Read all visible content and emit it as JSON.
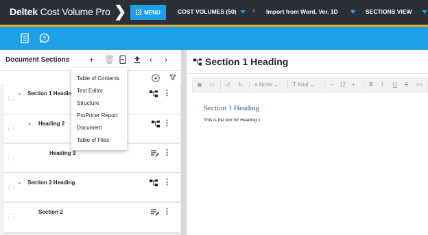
{
  "topbar": {
    "logo_brand": "Deltek",
    "logo_product": "Cost Volume Pro",
    "menu_label": "MENU",
    "cost_volumes": "COST VOLUMES (50)",
    "import_label": "Import from Word, Ver. 1D",
    "view_label": "SECTIONS VIEW",
    "brand_color": "#2b3038",
    "accent": "#1ea0e8",
    "gold": "#e8a92a"
  },
  "bluebar": {
    "icons": [
      "document-list-icon",
      "help-icon"
    ]
  },
  "left_panel": {
    "title": "Document Sections",
    "header_icons": [
      "add-icon",
      "trash-icon",
      "mobile-icon",
      "upload-icon",
      "chevron-left-icon",
      "chevron-right-icon"
    ],
    "rows": [
      {
        "label": "Section 1 Heading",
        "expanded": true,
        "icon": "structure-icon"
      },
      {
        "label": "Heading 2",
        "expanded": true,
        "icon": "structure-icon"
      },
      {
        "label": "Heading 3",
        "expanded": false,
        "icon": "edit-text-icon"
      },
      {
        "label": "Section 2 Heading",
        "expanded": true,
        "icon": "structure-icon"
      },
      {
        "label": "Section 2",
        "expanded": false,
        "icon": "edit-text-icon"
      }
    ]
  },
  "dropdown": {
    "items": [
      "Table of Contents",
      "Text Editor",
      "Structure",
      "ProPricer Report",
      "Document",
      "Table of Files"
    ]
  },
  "right_panel": {
    "title": "Section 1 Heading",
    "toolbar": {
      "paragraph_style": "None",
      "font": "Arial",
      "font_size": "12",
      "bold": "B",
      "italic": "I",
      "underline": "U",
      "strike": "S",
      "code": "<>"
    },
    "editor": {
      "heading": "Section 1 Heading",
      "text": "This is the text for Heading 1"
    }
  }
}
